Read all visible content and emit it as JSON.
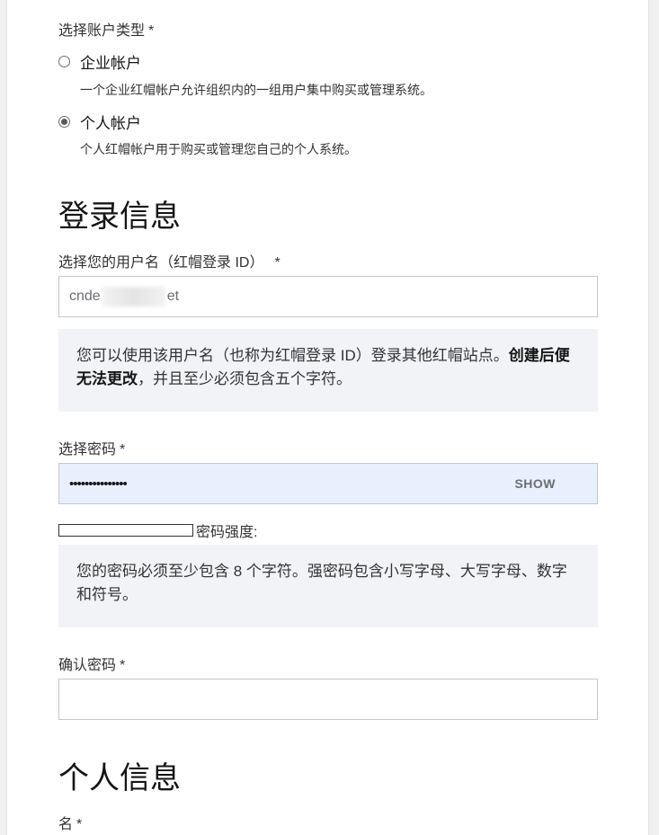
{
  "account_type": {
    "label": "选择账户类型",
    "required_mark": "*",
    "options": [
      {
        "label": "企业帐户",
        "description": "一个企业红帽帐户允许组织内的一组用户集中购买或管理系统。",
        "checked": false
      },
      {
        "label": "个人帐户",
        "description": "个人红帽帐户用于购买或管理您自己的个人系统。",
        "checked": true
      }
    ]
  },
  "login_section": {
    "title": "登录信息",
    "username": {
      "label": "选择您的用户名（红帽登录 ID）",
      "required_mark": "*",
      "value_prefix": "cnde",
      "value_suffix": "et",
      "hint_text": "您可以使用该用户名（也称为红帽登录 ID）登录其他红帽站点。",
      "hint_bold": "创建后便无法更改",
      "hint_tail": "，并且至少必须包含五个字符。"
    },
    "password": {
      "label": "选择密码",
      "required_mark": "*",
      "value": "•••••••••••••••",
      "show_label": "SHOW",
      "strength_label": "密码强度:",
      "strength_value": 0,
      "hint": "您的密码必须至少包含 8 个字符。强密码包含小写字母、大写字母、数字和符号。"
    },
    "confirm_password": {
      "label": "确认密码",
      "required_mark": "*",
      "value": ""
    }
  },
  "personal_section": {
    "title": "个人信息",
    "first_name": {
      "label": "名",
      "required_mark": "*"
    }
  }
}
